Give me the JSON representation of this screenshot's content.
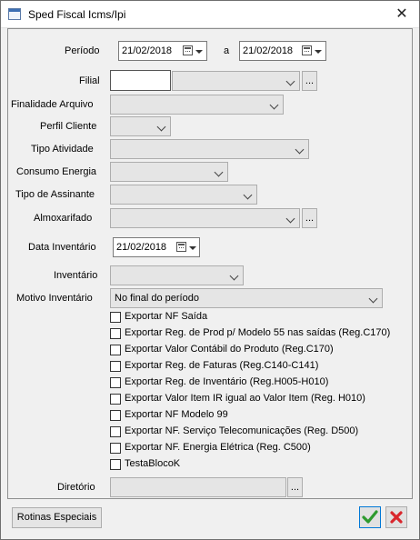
{
  "window": {
    "title": "Sped Fiscal Icms/Ipi",
    "close_symbol": "✕"
  },
  "form": {
    "periodo": {
      "label": "Período",
      "start": "21/02/2018",
      "separator": "a",
      "end": "21/02/2018"
    },
    "filial": {
      "label": "Filial",
      "code": "",
      "value": "",
      "button": "..."
    },
    "finalidade_arquivo": {
      "label": "Finalidade Arquivo",
      "value": ""
    },
    "perfil_cliente": {
      "label": "Perfil Cliente",
      "value": ""
    },
    "tipo_atividade": {
      "label": "Tipo Atividade",
      "value": ""
    },
    "consumo_energia": {
      "label": "Consumo Energia",
      "value": ""
    },
    "tipo_assinante": {
      "label": "Tipo de Assinante",
      "value": ""
    },
    "almoxarifado": {
      "label": "Almoxarifado",
      "value": "",
      "button": "..."
    },
    "data_inventario": {
      "label": "Data Inventário",
      "value": "21/02/2018"
    },
    "inventario": {
      "label": "Inventário",
      "value": ""
    },
    "motivo_inventario": {
      "label": "Motivo Inventário",
      "value": "No final do período"
    },
    "checkboxes": [
      {
        "label": "Exportar NF Saída",
        "checked": false
      },
      {
        "label": "Exportar Reg. de Prod p/ Modelo 55 nas saídas (Reg.C170)",
        "checked": false
      },
      {
        "label": "Exportar Valor Contábil do Produto (Reg.C170)",
        "checked": false
      },
      {
        "label": "Exportar Reg. de Faturas (Reg.C140-C141)",
        "checked": false
      },
      {
        "label": "Exportar Reg. de Inventário (Reg.H005-H010)",
        "checked": false
      },
      {
        "label": "Exportar Valor Item IR igual ao Valor Item (Reg. H010)",
        "checked": false
      },
      {
        "label": "Exportar NF Modelo 99",
        "checked": false
      },
      {
        "label": "Exportar NF. Serviço Telecomunicações (Reg. D500)",
        "checked": false
      },
      {
        "label": "Exportar NF. Energia Elétrica (Reg. C500)",
        "checked": false
      },
      {
        "label": "TestaBlocoK",
        "checked": false
      }
    ],
    "diretorio": {
      "label": "Diretório",
      "value": "",
      "button": "..."
    }
  },
  "footer": {
    "rotinas_label": "Rotinas Especiais",
    "ok_icon": "check-icon",
    "cancel_icon": "x-icon",
    "ok_color": "#2e9a2e",
    "cancel_color": "#d9262c"
  }
}
